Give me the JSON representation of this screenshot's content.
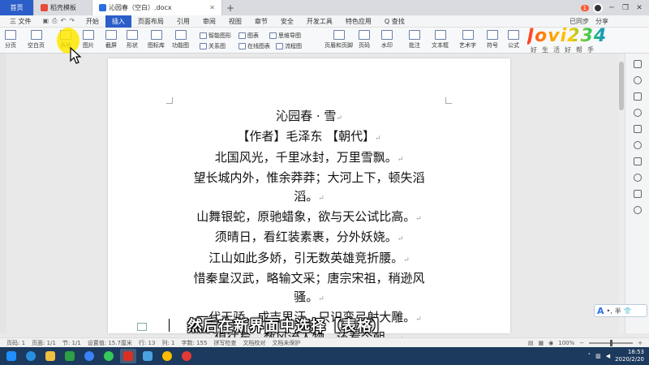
{
  "tabs": [
    {
      "label": "首页"
    },
    {
      "label": "稻壳模板"
    },
    {
      "label": "沁园春（空白）.docx"
    }
  ],
  "window": {
    "sync_label": "已同步",
    "share_label": "分享",
    "badge": "1"
  },
  "menu": {
    "file_label": "三 文件",
    "items": [
      "开始",
      "插入",
      "页面布局",
      "引用",
      "审阅",
      "视图",
      "章节",
      "安全",
      "开发工具",
      "特色应用"
    ],
    "selected": "插入",
    "search_label": "Q 查找",
    "right": [
      "批注",
      "分享"
    ]
  },
  "ribbon": {
    "large": [
      "分页",
      "空白页",
      "表格",
      "图片",
      "截屏",
      "形状",
      "图标库",
      "功能图",
      "页眉和页脚",
      "页码",
      "水印",
      "批注",
      "文本框",
      "艺术字",
      "符号",
      "公式"
    ],
    "small": [
      "智能图形",
      "图表",
      "思维导图",
      "关系图",
      "在线图表",
      "流程图"
    ]
  },
  "logo": {
    "text": "Jovi234",
    "subtitle": "好生活好帮手"
  },
  "document": {
    "lines": [
      "沁园春 · 雪",
      "【作者】毛泽东 【朝代】",
      "北国风光，千里冰封，万里雪飘。",
      "望长城内外，惟余莽莽；大河上下，顿失滔",
      "滔。",
      "山舞银蛇，原驰蜡象，欲与天公试比高。",
      "须晴日，看红装素裹，分外妖娆。",
      "江山如此多娇，引无数英雄竞折腰。",
      "惜秦皇汉武，略输文采；唐宗宋祖，稍逊风",
      "骚。",
      "一代天骄，成吉思汗，只识弯弓射大雕。",
      "俱往矣，数风流人物，还看今朝。"
    ]
  },
  "subtitle": "然后在新界面中选择【表格】",
  "ime": {
    "label": "半"
  },
  "status": {
    "page": "页码: 1",
    "pages": "页面: 1/1",
    "section": "节: 1/1",
    "position": "设置值: 15.7厘米",
    "row": "行: 13",
    "col": "列: 1",
    "words": "字数: 155",
    "spell": "拼写检查",
    "doc_check": "文档校对",
    "unsaved": "文档未保护",
    "zoom": "100%"
  },
  "taskbar": {
    "time": "18:53",
    "date": "2020/2/20"
  },
  "colors": {
    "accent": "#2b5ec8",
    "highlight": "#ffe600"
  }
}
